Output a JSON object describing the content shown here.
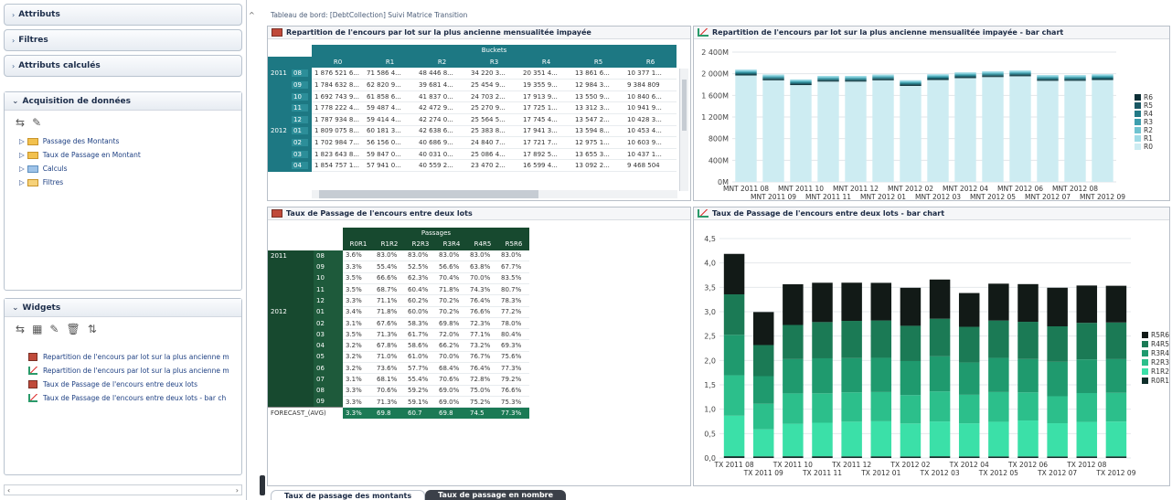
{
  "left": {
    "sections": [
      "Attributs",
      "Filtres",
      "Attributs calculés"
    ],
    "acquisition": {
      "title": "Acquisition de données",
      "items": [
        "Passage des Montants",
        "Taux de Passage en Montant",
        "Calculs",
        "Filtres"
      ]
    },
    "widgets": {
      "title": "Widgets",
      "items": [
        "Repartition de l'encours par lot sur la plus ancienne m",
        "Repartition de l'encours par lot sur la plus ancienne m",
        "Taux de Passage de l'encours entre deux lots",
        "Taux de Passage de l'encours entre deux lots - bar ch"
      ]
    }
  },
  "breadcrumb": "Tableau de bord: [DebtCollection] Suivi Matrice Transition",
  "panels": {
    "p1": "Repartition de l'encours par lot sur la plus ancienne mensualitée impayée",
    "p2": "Repartition de l'encours par lot sur la plus ancienne mensualitée impayée - bar chart",
    "p3": "Taux de Passage de l'encours entre deux lots",
    "p4": "Taux de Passage de l'encours entre deux lots - bar chart"
  },
  "table1": {
    "group": "Buckets",
    "cols": [
      "R0",
      "R1",
      "R2",
      "R3",
      "R4",
      "R5",
      "R6"
    ],
    "rows": [
      {
        "y": "2011",
        "m": "08",
        "v": [
          "1 876 521 6...",
          "71 586 4...",
          "48 446 8...",
          "34 220 3...",
          "20 351 4...",
          "13 861 6...",
          "10 377 1..."
        ]
      },
      {
        "y": "",
        "m": "09",
        "v": [
          "1 784 632 8...",
          "62 820 9...",
          "39 681 4...",
          "25 454 9...",
          "19 355 9...",
          "12 984 3...",
          "9 384 809"
        ]
      },
      {
        "y": "",
        "m": "10",
        "v": [
          "1 692 743 9...",
          "61 858 6...",
          "41 837 0...",
          "24 703 2...",
          "17 913 9...",
          "13 550 9...",
          "10 840 6..."
        ]
      },
      {
        "y": "",
        "m": "11",
        "v": [
          "1 778 222 4...",
          "59 487 4...",
          "42 472 9...",
          "25 270 9...",
          "17 725 1...",
          "13 312 3...",
          "10 941 9..."
        ]
      },
      {
        "y": "",
        "m": "12",
        "v": [
          "1 787 934 8...",
          "59 414 4...",
          "42 274 0...",
          "25 564 5...",
          "17 745 4...",
          "13 547 2...",
          "10 428 3..."
        ]
      },
      {
        "y": "2012",
        "m": "01",
        "v": [
          "1 809 075 8...",
          "60 181 3...",
          "42 638 6...",
          "25 383 8...",
          "17 941 3...",
          "13 594 8...",
          "10 453 4..."
        ]
      },
      {
        "y": "",
        "m": "02",
        "v": [
          "1 702 984 7...",
          "56 156 0...",
          "40 686 9...",
          "24 840 7...",
          "17 721 7...",
          "12 975 1...",
          "10 603 9..."
        ]
      },
      {
        "y": "",
        "m": "03",
        "v": [
          "1 823 643 8...",
          "59 847 0...",
          "40 031 0...",
          "25 086 4...",
          "17 892 5...",
          "13 655 3...",
          "10 437 1..."
        ]
      },
      {
        "y": "",
        "m": "04",
        "v": [
          "1 854 757 1...",
          "57 941 0...",
          "40 559 2...",
          "23 470 2...",
          "16 599 4...",
          "13 092 2...",
          "9 468 504"
        ]
      }
    ]
  },
  "table2": {
    "group": "Passages",
    "cols": [
      "R0R1",
      "R1R2",
      "R2R3",
      "R3R4",
      "R4R5",
      "R5R6"
    ],
    "rows": [
      {
        "y": "2011",
        "m": "08",
        "v": [
          "3.6%",
          "83.0%",
          "83.0%",
          "83.0%",
          "83.0%",
          "83.0%"
        ]
      },
      {
        "y": "",
        "m": "09",
        "v": [
          "3.3%",
          "55.4%",
          "52.5%",
          "56.6%",
          "63.8%",
          "67.7%"
        ]
      },
      {
        "y": "",
        "m": "10",
        "v": [
          "3.5%",
          "66.6%",
          "62.3%",
          "70.4%",
          "70.0%",
          "83.5%"
        ]
      },
      {
        "y": "",
        "m": "11",
        "v": [
          "3.5%",
          "68.7%",
          "60.4%",
          "71.8%",
          "74.3%",
          "80.7%"
        ]
      },
      {
        "y": "",
        "m": "12",
        "v": [
          "3.3%",
          "71.1%",
          "60.2%",
          "70.2%",
          "76.4%",
          "78.3%"
        ]
      },
      {
        "y": "2012",
        "m": "01",
        "v": [
          "3.4%",
          "71.8%",
          "60.0%",
          "70.2%",
          "76.6%",
          "77.2%"
        ]
      },
      {
        "y": "",
        "m": "02",
        "v": [
          "3.1%",
          "67.6%",
          "58.3%",
          "69.8%",
          "72.3%",
          "78.0%"
        ]
      },
      {
        "y": "",
        "m": "03",
        "v": [
          "3.5%",
          "71.3%",
          "61.7%",
          "72.0%",
          "77.1%",
          "80.4%"
        ]
      },
      {
        "y": "",
        "m": "04",
        "v": [
          "3.2%",
          "67.8%",
          "58.6%",
          "66.2%",
          "73.2%",
          "69.3%"
        ]
      },
      {
        "y": "",
        "m": "05",
        "v": [
          "3.2%",
          "71.0%",
          "61.0%",
          "70.0%",
          "76.7%",
          "75.6%"
        ]
      },
      {
        "y": "",
        "m": "06",
        "v": [
          "3.2%",
          "73.6%",
          "57.7%",
          "68.4%",
          "76.4%",
          "77.3%"
        ]
      },
      {
        "y": "",
        "m": "07",
        "v": [
          "3.1%",
          "68.1%",
          "55.4%",
          "70.6%",
          "72.8%",
          "79.2%"
        ]
      },
      {
        "y": "",
        "m": "08",
        "v": [
          "3.3%",
          "70.6%",
          "59.2%",
          "69.0%",
          "75.0%",
          "76.6%"
        ]
      },
      {
        "y": "",
        "m": "09",
        "v": [
          "3.3%",
          "71.3%",
          "59.1%",
          "69.0%",
          "75.2%",
          "75.3%"
        ]
      }
    ],
    "forecast": {
      "label": "FORECAST_(AVG)",
      "v": [
        "3.3%",
        "69.8",
        "60.7",
        "69.8",
        "74.5",
        "77.3%"
      ]
    }
  },
  "chart_data": [
    {
      "type": "bar",
      "stacked": true,
      "categories": [
        "MNT 2011 08",
        "MNT 2011 09",
        "MNT 2011 10",
        "MNT 2011 11",
        "MNT 2011 12",
        "MNT 2012 01",
        "MNT 2012 02",
        "MNT 2012 03",
        "MNT 2012 04",
        "MNT 2012 05",
        "MNT 2012 06",
        "MNT 2012 07",
        "MNT 2012 08",
        "MNT 2012 09"
      ],
      "yticks": [
        "0M",
        "400M",
        "800M",
        "1 200M",
        "1 600M",
        "2 000M",
        "2 400M"
      ],
      "ylim": [
        0,
        2400
      ],
      "series": [
        {
          "name": "R6"
        },
        {
          "name": "R5"
        },
        {
          "name": "R4"
        },
        {
          "name": "R3"
        },
        {
          "name": "R2"
        },
        {
          "name": "R1"
        },
        {
          "name": "R0"
        }
      ],
      "totals": [
        2075,
        1985,
        1895,
        1960,
        1960,
        1985,
        1880,
        1990,
        2025,
        2045,
        2060,
        1975,
        1975,
        1990
      ],
      "colors": {
        "R0": "#cdecf2",
        "R1": "#9fdbe6",
        "R2": "#6fc3d0",
        "R3": "#3e9fae",
        "R4": "#237a86",
        "R5": "#195763",
        "R6": "#0d2f36"
      },
      "legend": "right"
    },
    {
      "type": "bar",
      "stacked": true,
      "categories": [
        "TX 2011 08",
        "TX 2011 09",
        "TX 2011 10",
        "TX 2011 11",
        "TX 2011 12",
        "TX 2012 01",
        "TX 2012 02",
        "TX 2012 03",
        "TX 2012 04",
        "TX 2012 05",
        "TX 2012 06",
        "TX 2012 07",
        "TX 2012 08",
        "TX 2012 09"
      ],
      "yticks": [
        "0,0",
        "0,5",
        "1,0",
        "1,5",
        "2,0",
        "2,5",
        "3,0",
        "3,5",
        "4,0",
        "4,5"
      ],
      "ylim": [
        0,
        4.5
      ],
      "series": [
        {
          "name": "R5R6",
          "values": [
            0.83,
            0.677,
            0.835,
            0.807,
            0.783,
            0.772,
            0.78,
            0.804,
            0.693,
            0.756,
            0.773,
            0.792,
            0.766,
            0.753
          ]
        },
        {
          "name": "R4R5",
          "values": [
            0.83,
            0.638,
            0.7,
            0.743,
            0.764,
            0.766,
            0.723,
            0.771,
            0.732,
            0.767,
            0.764,
            0.728,
            0.75,
            0.752
          ]
        },
        {
          "name": "R3R4",
          "values": [
            0.83,
            0.566,
            0.704,
            0.718,
            0.702,
            0.702,
            0.698,
            0.72,
            0.662,
            0.7,
            0.684,
            0.706,
            0.69,
            0.69
          ]
        },
        {
          "name": "R2R3",
          "values": [
            0.83,
            0.525,
            0.623,
            0.604,
            0.602,
            0.6,
            0.583,
            0.617,
            0.586,
            0.61,
            0.577,
            0.554,
            0.592,
            0.591
          ]
        },
        {
          "name": "R1R2",
          "values": [
            0.83,
            0.554,
            0.666,
            0.687,
            0.711,
            0.718,
            0.676,
            0.713,
            0.678,
            0.71,
            0.736,
            0.681,
            0.706,
            0.713
          ]
        },
        {
          "name": "R0R1",
          "values": [
            0.036,
            0.033,
            0.035,
            0.035,
            0.033,
            0.034,
            0.031,
            0.035,
            0.032,
            0.032,
            0.032,
            0.031,
            0.033,
            0.033
          ]
        }
      ],
      "colors": {
        "R0R1": "#0f2f2a",
        "R1R2": "#3be0a8",
        "R2R3": "#2cbf8b",
        "R3R4": "#1f9a6e",
        "R4R5": "#1b7a55",
        "R5R6": "#121a17"
      },
      "legend": "right"
    }
  ],
  "tabs": [
    {
      "label": "Taux de passage des montants",
      "active": true
    },
    {
      "label": "Taux de passage en nombre",
      "active": false
    }
  ]
}
